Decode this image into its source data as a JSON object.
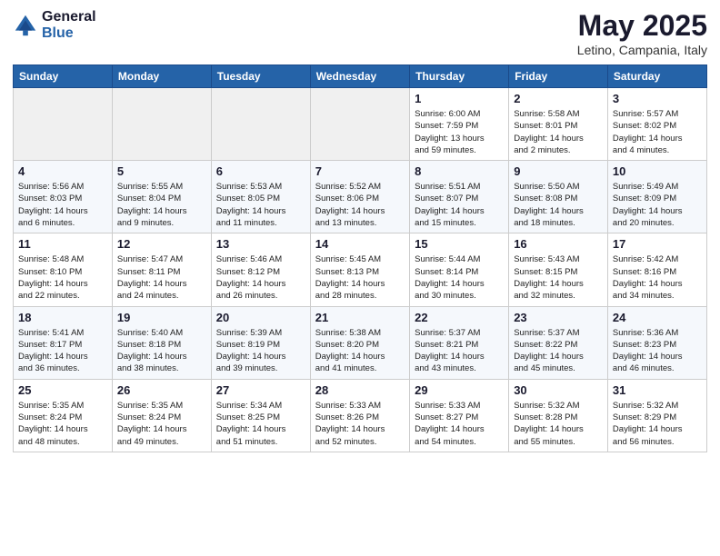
{
  "header": {
    "logo_general": "General",
    "logo_blue": "Blue",
    "title": "May 2025",
    "location": "Letino, Campania, Italy"
  },
  "weekdays": [
    "Sunday",
    "Monday",
    "Tuesday",
    "Wednesday",
    "Thursday",
    "Friday",
    "Saturday"
  ],
  "weeks": [
    {
      "days": [
        {
          "date": "",
          "info": ""
        },
        {
          "date": "",
          "info": ""
        },
        {
          "date": "",
          "info": ""
        },
        {
          "date": "",
          "info": ""
        },
        {
          "date": "1",
          "info": "Sunrise: 6:00 AM\nSunset: 7:59 PM\nDaylight: 13 hours\nand 59 minutes."
        },
        {
          "date": "2",
          "info": "Sunrise: 5:58 AM\nSunset: 8:01 PM\nDaylight: 14 hours\nand 2 minutes."
        },
        {
          "date": "3",
          "info": "Sunrise: 5:57 AM\nSunset: 8:02 PM\nDaylight: 14 hours\nand 4 minutes."
        }
      ]
    },
    {
      "days": [
        {
          "date": "4",
          "info": "Sunrise: 5:56 AM\nSunset: 8:03 PM\nDaylight: 14 hours\nand 6 minutes."
        },
        {
          "date": "5",
          "info": "Sunrise: 5:55 AM\nSunset: 8:04 PM\nDaylight: 14 hours\nand 9 minutes."
        },
        {
          "date": "6",
          "info": "Sunrise: 5:53 AM\nSunset: 8:05 PM\nDaylight: 14 hours\nand 11 minutes."
        },
        {
          "date": "7",
          "info": "Sunrise: 5:52 AM\nSunset: 8:06 PM\nDaylight: 14 hours\nand 13 minutes."
        },
        {
          "date": "8",
          "info": "Sunrise: 5:51 AM\nSunset: 8:07 PM\nDaylight: 14 hours\nand 15 minutes."
        },
        {
          "date": "9",
          "info": "Sunrise: 5:50 AM\nSunset: 8:08 PM\nDaylight: 14 hours\nand 18 minutes."
        },
        {
          "date": "10",
          "info": "Sunrise: 5:49 AM\nSunset: 8:09 PM\nDaylight: 14 hours\nand 20 minutes."
        }
      ]
    },
    {
      "days": [
        {
          "date": "11",
          "info": "Sunrise: 5:48 AM\nSunset: 8:10 PM\nDaylight: 14 hours\nand 22 minutes."
        },
        {
          "date": "12",
          "info": "Sunrise: 5:47 AM\nSunset: 8:11 PM\nDaylight: 14 hours\nand 24 minutes."
        },
        {
          "date": "13",
          "info": "Sunrise: 5:46 AM\nSunset: 8:12 PM\nDaylight: 14 hours\nand 26 minutes."
        },
        {
          "date": "14",
          "info": "Sunrise: 5:45 AM\nSunset: 8:13 PM\nDaylight: 14 hours\nand 28 minutes."
        },
        {
          "date": "15",
          "info": "Sunrise: 5:44 AM\nSunset: 8:14 PM\nDaylight: 14 hours\nand 30 minutes."
        },
        {
          "date": "16",
          "info": "Sunrise: 5:43 AM\nSunset: 8:15 PM\nDaylight: 14 hours\nand 32 minutes."
        },
        {
          "date": "17",
          "info": "Sunrise: 5:42 AM\nSunset: 8:16 PM\nDaylight: 14 hours\nand 34 minutes."
        }
      ]
    },
    {
      "days": [
        {
          "date": "18",
          "info": "Sunrise: 5:41 AM\nSunset: 8:17 PM\nDaylight: 14 hours\nand 36 minutes."
        },
        {
          "date": "19",
          "info": "Sunrise: 5:40 AM\nSunset: 8:18 PM\nDaylight: 14 hours\nand 38 minutes."
        },
        {
          "date": "20",
          "info": "Sunrise: 5:39 AM\nSunset: 8:19 PM\nDaylight: 14 hours\nand 39 minutes."
        },
        {
          "date": "21",
          "info": "Sunrise: 5:38 AM\nSunset: 8:20 PM\nDaylight: 14 hours\nand 41 minutes."
        },
        {
          "date": "22",
          "info": "Sunrise: 5:37 AM\nSunset: 8:21 PM\nDaylight: 14 hours\nand 43 minutes."
        },
        {
          "date": "23",
          "info": "Sunrise: 5:37 AM\nSunset: 8:22 PM\nDaylight: 14 hours\nand 45 minutes."
        },
        {
          "date": "24",
          "info": "Sunrise: 5:36 AM\nSunset: 8:23 PM\nDaylight: 14 hours\nand 46 minutes."
        }
      ]
    },
    {
      "days": [
        {
          "date": "25",
          "info": "Sunrise: 5:35 AM\nSunset: 8:24 PM\nDaylight: 14 hours\nand 48 minutes."
        },
        {
          "date": "26",
          "info": "Sunrise: 5:35 AM\nSunset: 8:24 PM\nDaylight: 14 hours\nand 49 minutes."
        },
        {
          "date": "27",
          "info": "Sunrise: 5:34 AM\nSunset: 8:25 PM\nDaylight: 14 hours\nand 51 minutes."
        },
        {
          "date": "28",
          "info": "Sunrise: 5:33 AM\nSunset: 8:26 PM\nDaylight: 14 hours\nand 52 minutes."
        },
        {
          "date": "29",
          "info": "Sunrise: 5:33 AM\nSunset: 8:27 PM\nDaylight: 14 hours\nand 54 minutes."
        },
        {
          "date": "30",
          "info": "Sunrise: 5:32 AM\nSunset: 8:28 PM\nDaylight: 14 hours\nand 55 minutes."
        },
        {
          "date": "31",
          "info": "Sunrise: 5:32 AM\nSunset: 8:29 PM\nDaylight: 14 hours\nand 56 minutes."
        }
      ]
    }
  ]
}
